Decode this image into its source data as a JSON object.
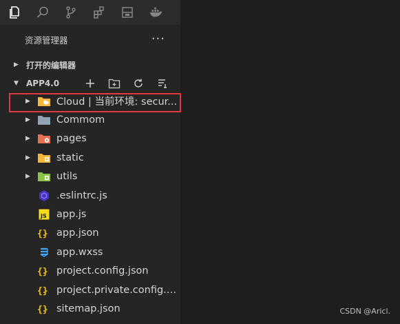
{
  "activity_bar": {
    "icons": [
      "explorer-icon",
      "search-icon",
      "source-control-icon",
      "extensions-icon",
      "remote-icon",
      "docker-icon"
    ]
  },
  "explorer": {
    "title": "资源管理器",
    "more": "···"
  },
  "sections": {
    "open_editors": "打开的编辑器",
    "project": "APP4.0"
  },
  "tree": [
    {
      "type": "folder",
      "label": "Cloud | 当前环境: secur...",
      "icon": "folder-cloud-icon",
      "color": "#f5b83d"
    },
    {
      "type": "folder",
      "label": "Commom",
      "icon": "folder-icon",
      "color": "#8fa5b3"
    },
    {
      "type": "folder",
      "label": "pages",
      "icon": "folder-pages-icon",
      "color": "#e57051"
    },
    {
      "type": "folder",
      "label": "static",
      "icon": "folder-static-icon",
      "color": "#f5b83d"
    },
    {
      "type": "folder",
      "label": "utils",
      "icon": "folder-utils-icon",
      "color": "#8bc34a"
    },
    {
      "type": "file",
      "label": ".eslintrc.js",
      "icon": "eslint-icon",
      "color": "#4b32c3"
    },
    {
      "type": "file",
      "label": "app.js",
      "icon": "js-icon",
      "color": "#f5de19"
    },
    {
      "type": "file",
      "label": "app.json",
      "icon": "json-icon",
      "color": "#f5c400"
    },
    {
      "type": "file",
      "label": "app.wxss",
      "icon": "css-icon",
      "color": "#42a5f5"
    },
    {
      "type": "file",
      "label": "project.config.json",
      "icon": "json-icon",
      "color": "#f5c400"
    },
    {
      "type": "file",
      "label": "project.private.config.js...",
      "icon": "json-icon",
      "color": "#f5c400"
    },
    {
      "type": "file",
      "label": "sitemap.json",
      "icon": "json-icon",
      "color": "#f5c400"
    }
  ],
  "watermark": "CSDN @Aricl."
}
